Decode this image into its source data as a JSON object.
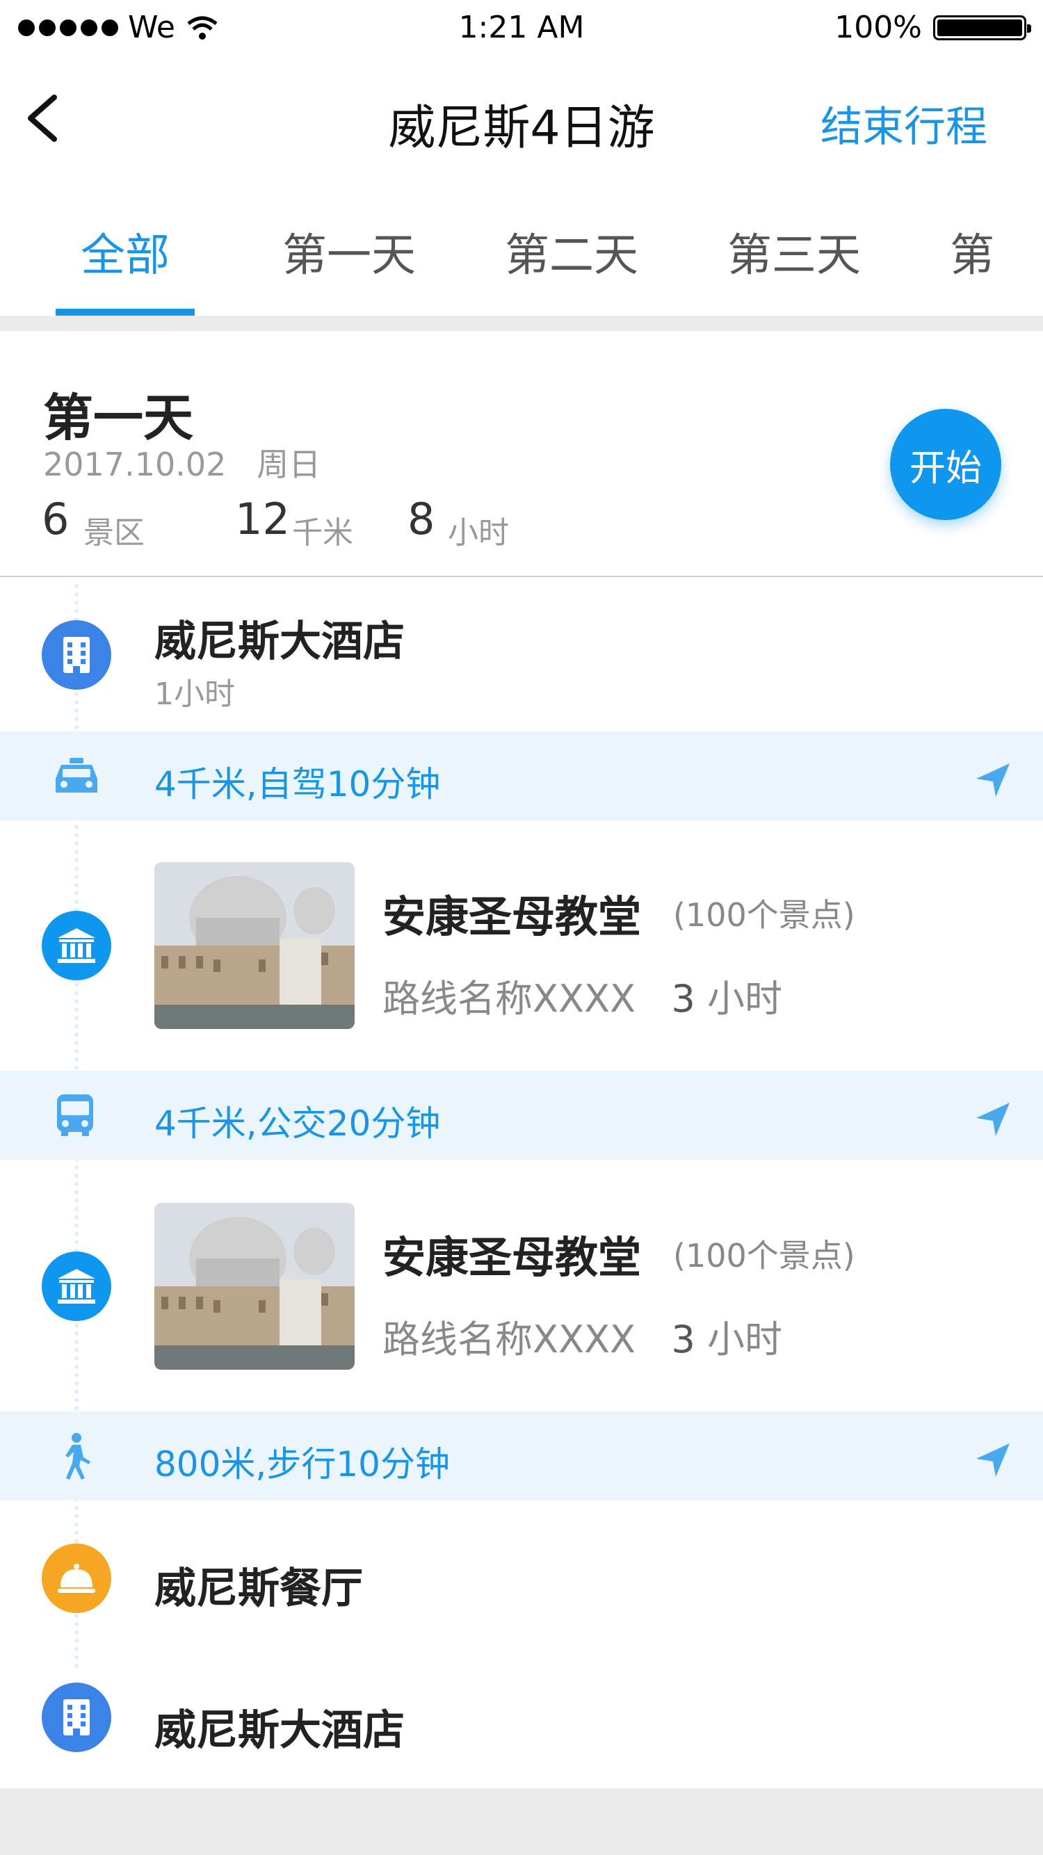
{
  "status_bar": {
    "carrier": "We",
    "time": "1:21 AM",
    "battery": "100%"
  },
  "nav": {
    "title": "威尼斯4日游",
    "end_trip": "结束行程"
  },
  "tabs": [
    "全部",
    "第一天",
    "第二天",
    "第三天",
    "第"
  ],
  "day": {
    "title": "第一天",
    "date": "2017.10.02",
    "weekday": "周日",
    "stats": [
      {
        "value": "6",
        "unit": "景区"
      },
      {
        "value": "12",
        "unit": "千米"
      },
      {
        "value": "8",
        "unit": "小时"
      }
    ],
    "start_label": "开始"
  },
  "itinerary": {
    "hotel_start": {
      "name": "威尼斯大酒店",
      "duration": "1小时"
    },
    "transport_1": {
      "text": "4千米,自驾10分钟",
      "icon": "taxi-icon"
    },
    "spot_1": {
      "name": "安康圣母教堂",
      "count": "(100个景点)",
      "route": "路线名称XXXX",
      "hours": "3",
      "hours_unit": "小时"
    },
    "transport_2": {
      "text": "4千米,公交20分钟",
      "icon": "bus-icon"
    },
    "spot_2": {
      "name": "安康圣母教堂",
      "count": "(100个景点)",
      "route": "路线名称XXXX",
      "hours": "3",
      "hours_unit": "小时"
    },
    "transport_3": {
      "text": "800米,步行10分钟",
      "icon": "walk-icon"
    },
    "restaurant": {
      "name": "威尼斯餐厅"
    },
    "hotel_end": {
      "name": "威尼斯大酒店"
    }
  },
  "colors": {
    "accent": "#1a94e6",
    "hotel": "#3b83e6",
    "restaurant": "#f5a623",
    "transport_bg": "#eaf5fd"
  }
}
